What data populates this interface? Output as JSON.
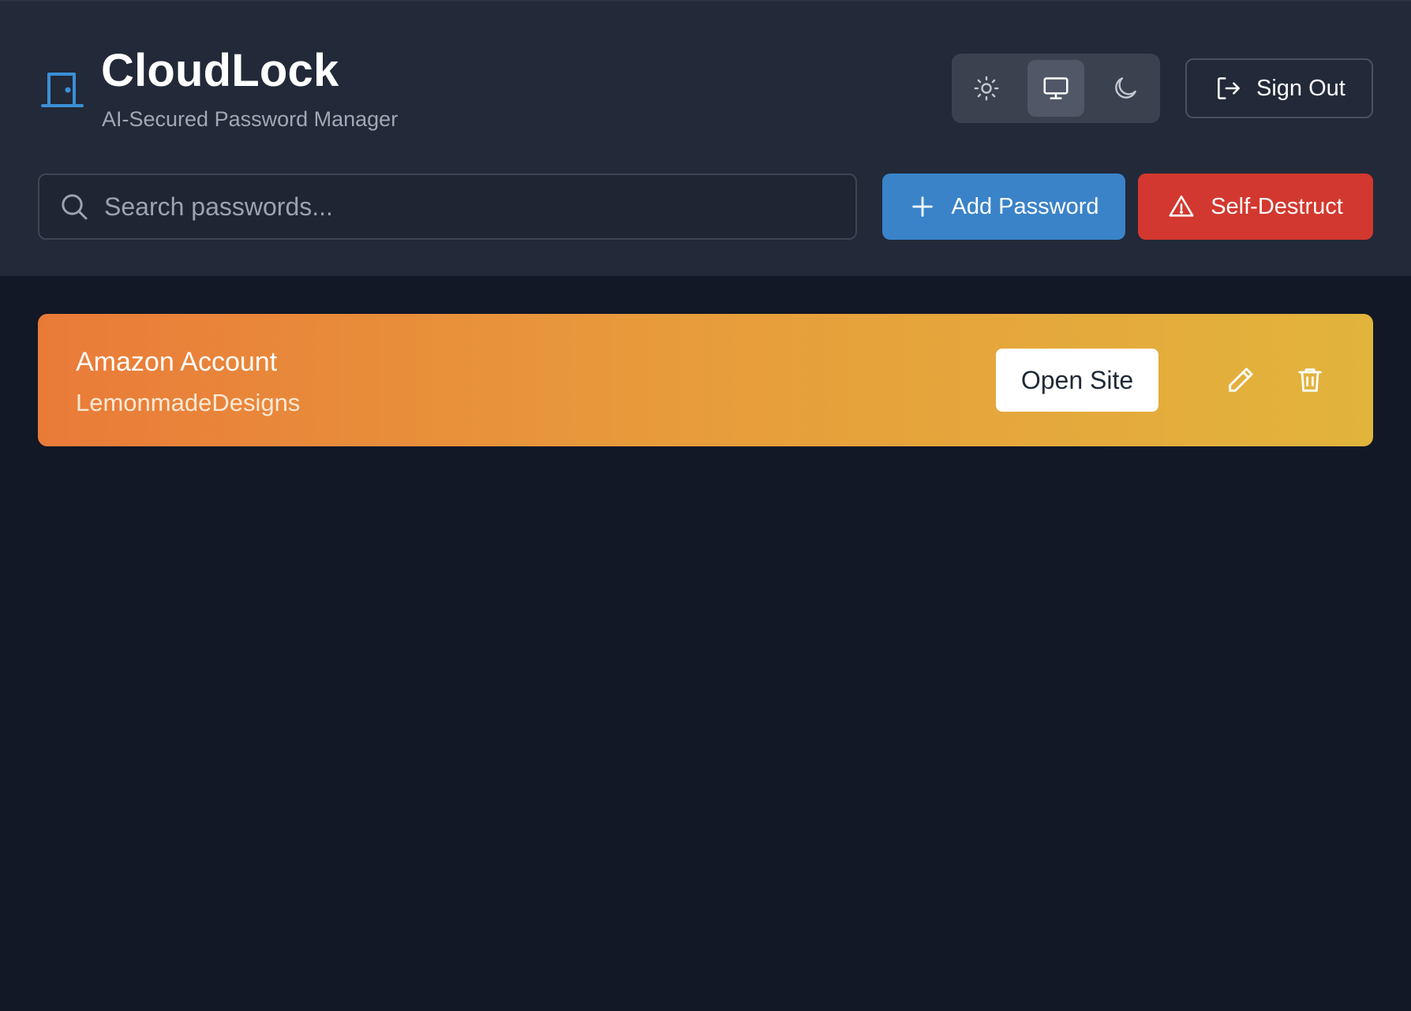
{
  "app": {
    "title": "CloudLock",
    "subtitle": "AI-Secured Password Manager"
  },
  "theme_switcher": {
    "options": [
      {
        "name": "light",
        "icon": "sun-icon",
        "active": false
      },
      {
        "name": "system",
        "icon": "monitor-icon",
        "active": true
      },
      {
        "name": "dark",
        "icon": "moon-icon",
        "active": false
      }
    ]
  },
  "header": {
    "sign_out_label": "Sign Out"
  },
  "search": {
    "placeholder": "Search passwords...",
    "value": ""
  },
  "toolbar": {
    "add_label": "Add Password",
    "destruct_label": "Self-Destruct"
  },
  "passwords": [
    {
      "name": "Amazon Account",
      "username": "LemonmadeDesigns",
      "open_label": "Open Site"
    }
  ],
  "colors": {
    "background": "#121826",
    "header": "#222938",
    "accent_blue": "#3a83c8",
    "danger_red": "#d2382f",
    "card_gradient_start": "#e97b39",
    "card_gradient_end": "#e2b43c"
  }
}
